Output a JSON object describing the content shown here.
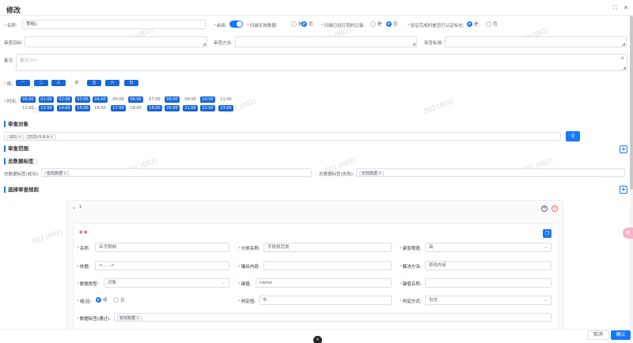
{
  "dialog": {
    "title": "修改"
  },
  "form": {
    "name_label": "名称:",
    "name_value": "策略1",
    "enabled_label": "启用:",
    "scan_invalid_label": "扫描无效数据:",
    "scan_modified_label": "扫描已经打钩的记录:",
    "verify_label": "验证完成时是否打认定标志:",
    "opt_yes": "是",
    "opt_no": "否",
    "audit_target_label": "审查目标:",
    "audit_method_label": "审查方法:",
    "audit_standard_label": "审查标准:",
    "remark_label": "备注:",
    "remark_placeholder": "备注!!!!!",
    "week_label": "周:",
    "week_days": [
      "一",
      "二",
      "三",
      "四",
      "五",
      "六",
      "日"
    ],
    "time_label": "时间:",
    "hours": [
      "00:00",
      "01:00",
      "02:00",
      "03:00",
      "04:00",
      "05:00",
      "06:00",
      "07:00",
      "08:00",
      "09:00",
      "10:00",
      "11:00",
      "12:00",
      "13:00",
      "14:00",
      "15:00",
      "16:00",
      "17:00",
      "18:00",
      "19:00",
      "20:00",
      "21:00",
      "22:00",
      "23:00"
    ]
  },
  "audit_target": {
    "title": "审查对象",
    "tags": [
      "001",
      "2025-5-6-h"
    ]
  },
  "audit_scope": {
    "title": "审查范围"
  },
  "total_tags": {
    "title": "总数据标签",
    "success_label": "总数据标签(成功):",
    "success_tag": "有效数据",
    "fail_label": "总数据标签(失败):",
    "fail_tag": "无效数据"
  },
  "rules": {
    "title": "选择审查规则",
    "panel_index": "1",
    "card": {
      "name_label": "名称:",
      "name_value": "名字限制",
      "category_label": "分类名称:",
      "category_value": "字段规范类",
      "urgency_label": "紧急程度:",
      "urgency_value": "高",
      "basis_label": "依据:",
      "basis_value": "<......>",
      "output_label": "输出内容:",
      "output_value": "",
      "solution_label": "解决方法:",
      "solution_value": "修改内容",
      "datatype_label": "数据类型:",
      "datatype_value": "对象",
      "keyvalue_label": "键值:",
      "keyvalue_value": "name",
      "keyname_label": "键值名称:",
      "keyname_value": "",
      "andor_label": "或/且:",
      "or_label": "或",
      "and_label": "且",
      "judge_value_label": "判定值:",
      "judge_value": "中",
      "judge_method_label": "判定方式:",
      "judge_method": "包含",
      "data_tag_label": "数据标签(通过):",
      "data_tag": "有效数据"
    }
  },
  "watermark": "002 (002)",
  "footer": {
    "cancel": "取消",
    "confirm": "确认"
  },
  "colors": {
    "accent": "#1677ff",
    "danger": "#f56c6c"
  }
}
